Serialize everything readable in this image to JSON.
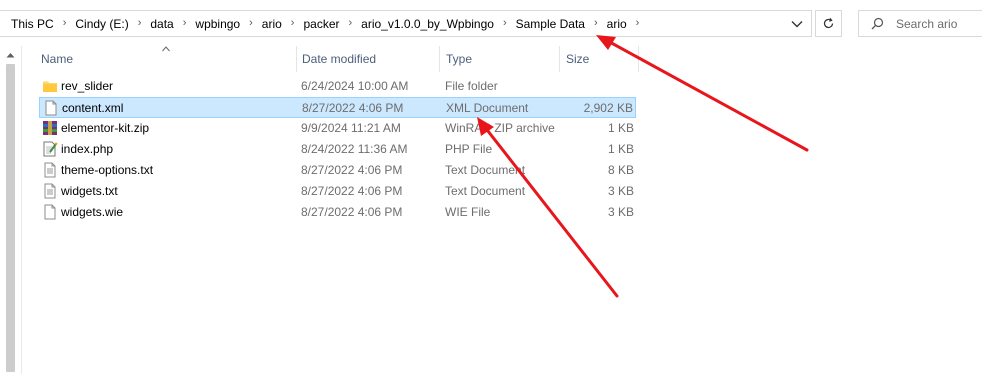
{
  "breadcrumb": [
    "This PC",
    "Cindy (E:)",
    "data",
    "wpbingo",
    "ario",
    "packer",
    "ario_v1.0.0_by_Wpbingo",
    "Sample Data",
    "ario"
  ],
  "search": {
    "placeholder": "Search ario"
  },
  "columns": {
    "name": "Name",
    "date": "Date modified",
    "type": "Type",
    "size": "Size"
  },
  "files": [
    {
      "name": "rev_slider",
      "date": "6/24/2024 10:00 AM",
      "type": "File folder",
      "size": "",
      "icon": "folder-icon",
      "selected": false
    },
    {
      "name": "content.xml",
      "date": "8/27/2022 4:06 PM",
      "type": "XML Document",
      "size": "2,902 KB",
      "icon": "xml-file-icon",
      "selected": true
    },
    {
      "name": "elementor-kit.zip",
      "date": "9/9/2024 11:21 AM",
      "type": "WinRAR ZIP archive",
      "size": "1 KB",
      "icon": "winrar-archive-icon",
      "selected": false
    },
    {
      "name": "index.php",
      "date": "8/24/2022 11:36 AM",
      "type": "PHP File",
      "size": "1 KB",
      "icon": "php-file-icon",
      "selected": false
    },
    {
      "name": "theme-options.txt",
      "date": "8/27/2022 4:06 PM",
      "type": "Text Document",
      "size": "8 KB",
      "icon": "text-file-icon",
      "selected": false
    },
    {
      "name": "widgets.txt",
      "date": "8/27/2022 4:06 PM",
      "type": "Text Document",
      "size": "3 KB",
      "icon": "text-file-icon",
      "selected": false
    },
    {
      "name": "widgets.wie",
      "date": "8/27/2022 4:06 PM",
      "type": "WIE File",
      "size": "3 KB",
      "icon": "generic-file-icon",
      "selected": false
    }
  ],
  "colors": {
    "selection_bg": "#cce8ff",
    "selection_border": "#99d1ff",
    "annotation_arrow": "#e8161b",
    "header_text": "#4c607a"
  }
}
